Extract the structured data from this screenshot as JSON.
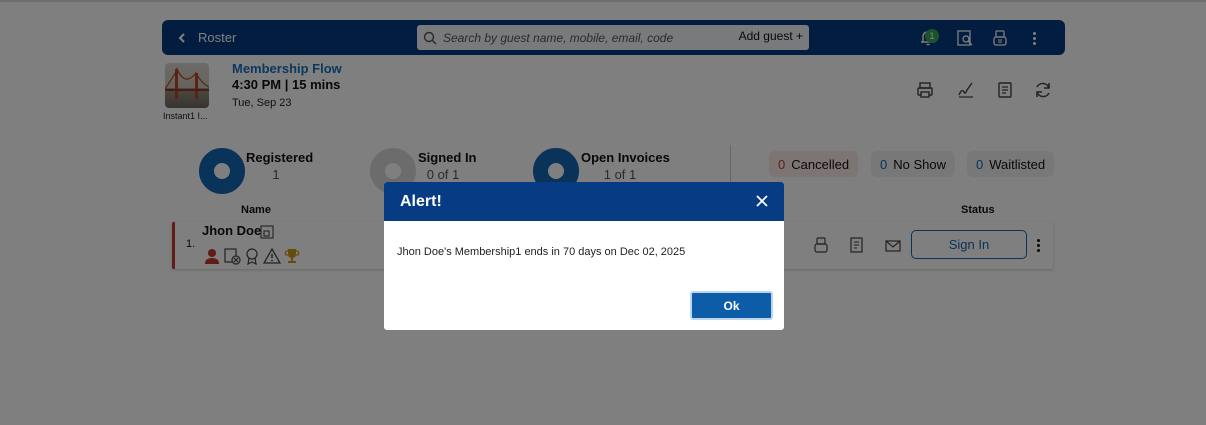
{
  "header": {
    "back_label": "Roster",
    "search_placeholder": "Search by guest name, mobile, email, code",
    "add_guest_label": "Add guest +",
    "notification_count": "1"
  },
  "session": {
    "thumbnail_caption": "Instant1 I...",
    "name": "Membership Flow",
    "time": "4:30 PM | 15 mins",
    "date": "Tue, Sep 23"
  },
  "stats": {
    "registered": {
      "label": "Registered",
      "value": "1"
    },
    "signed_in": {
      "label": "Signed In",
      "value": "0 of 1"
    },
    "open_invoices": {
      "label": "Open Invoices",
      "value": "1 of 1"
    },
    "cancelled": {
      "count": "0",
      "label": "Cancelled"
    },
    "no_show": {
      "count": "0",
      "label": "No Show"
    },
    "waitlisted": {
      "count": "0",
      "label": "Waitlisted"
    }
  },
  "table": {
    "col_name": "Name",
    "col_status": "Status",
    "rows": [
      {
        "index": "1.",
        "name": "Jhon Doe",
        "action": "Sign In"
      }
    ]
  },
  "alert": {
    "title": "Alert!",
    "message": "Jhon Doe's Membership1 ends in 70 days on Dec 02, 2025",
    "ok_label": "Ok"
  },
  "colors": {
    "header_bg": "#073b83",
    "accent": "#1467b2",
    "alert_red": "#c0392b",
    "badge_green": "#3aa655"
  }
}
